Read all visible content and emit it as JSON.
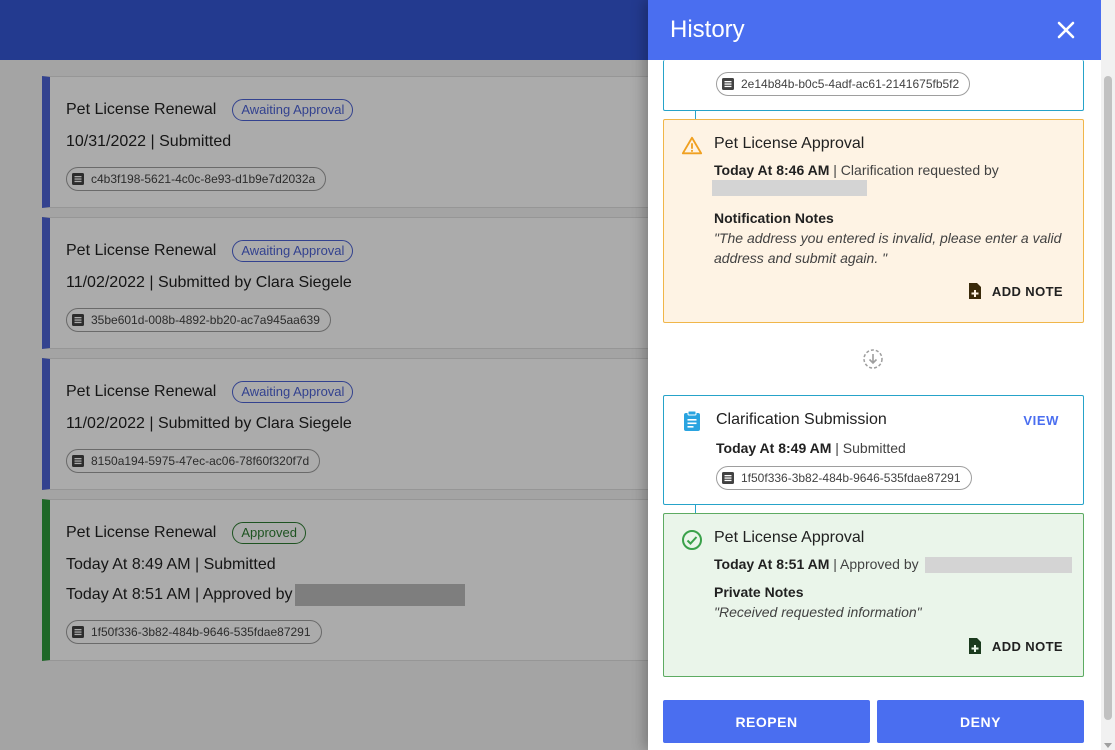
{
  "background": {
    "cards": [
      {
        "title": "Pet License Renewal",
        "badge": "Awaiting Approval",
        "line1": "10/31/2022 | Submitted",
        "line2": "",
        "id": "c4b3f198-5621-4c0c-8e93-d1b9e7d2032a"
      },
      {
        "title": "Pet License Renewal",
        "badge": "Awaiting Approval",
        "line1": "11/02/2022 | Submitted by Clara Siegele",
        "line2": "",
        "id": "35be601d-008b-4892-bb20-ac7a945aa639"
      },
      {
        "title": "Pet License Renewal",
        "badge": "Awaiting Approval",
        "line1": "11/02/2022 | Submitted by Clara Siegele",
        "line2": "",
        "id": "8150a194-5975-47ec-ac06-78f60f320f7d"
      },
      {
        "title": "Pet License Renewal",
        "badge": "Approved",
        "line1": "Today At 8:49 AM | Submitted",
        "line2": "Today At 8:51 AM | Approved by",
        "id": "1f50f336-3b82-484b-9646-535fdae87291"
      }
    ]
  },
  "drawer": {
    "title": "History",
    "close_icon": "close-icon",
    "top_item": {
      "id": "2e14b84b-b0c5-4adf-ac61-2141675fb5f2"
    },
    "warning_item": {
      "title": "Pet License Approval",
      "time": "Today At 8:46 AM",
      "action": " | Clarification requested by",
      "notes_label": "Notification Notes",
      "notes_text": "\"The address you entered is invalid, please enter a valid address and submit again. \"",
      "add_note": "ADD NOTE"
    },
    "clarification_item": {
      "title": "Clarification Submission",
      "view": "VIEW",
      "time": "Today At 8:49 AM",
      "action": " | Submitted",
      "id": "1f50f336-3b82-484b-9646-535fdae87291"
    },
    "approved_item": {
      "title": "Pet License Approval",
      "time": "Today At 8:51 AM",
      "action": " | Approved by",
      "notes_label": "Private Notes",
      "notes_text": "\"Received requested information\"",
      "add_note": "ADD NOTE"
    },
    "buttons": {
      "reopen": "REOPEN",
      "deny": "DENY"
    }
  },
  "colors": {
    "primary": "#4a6ef0",
    "header_bg": "#3557d6",
    "warning_bg": "#fef3e4",
    "warning_border": "#f0b64a",
    "success_bg": "#eaf5ea",
    "success_border": "#5dab62",
    "info_border": "#26a3c9"
  }
}
